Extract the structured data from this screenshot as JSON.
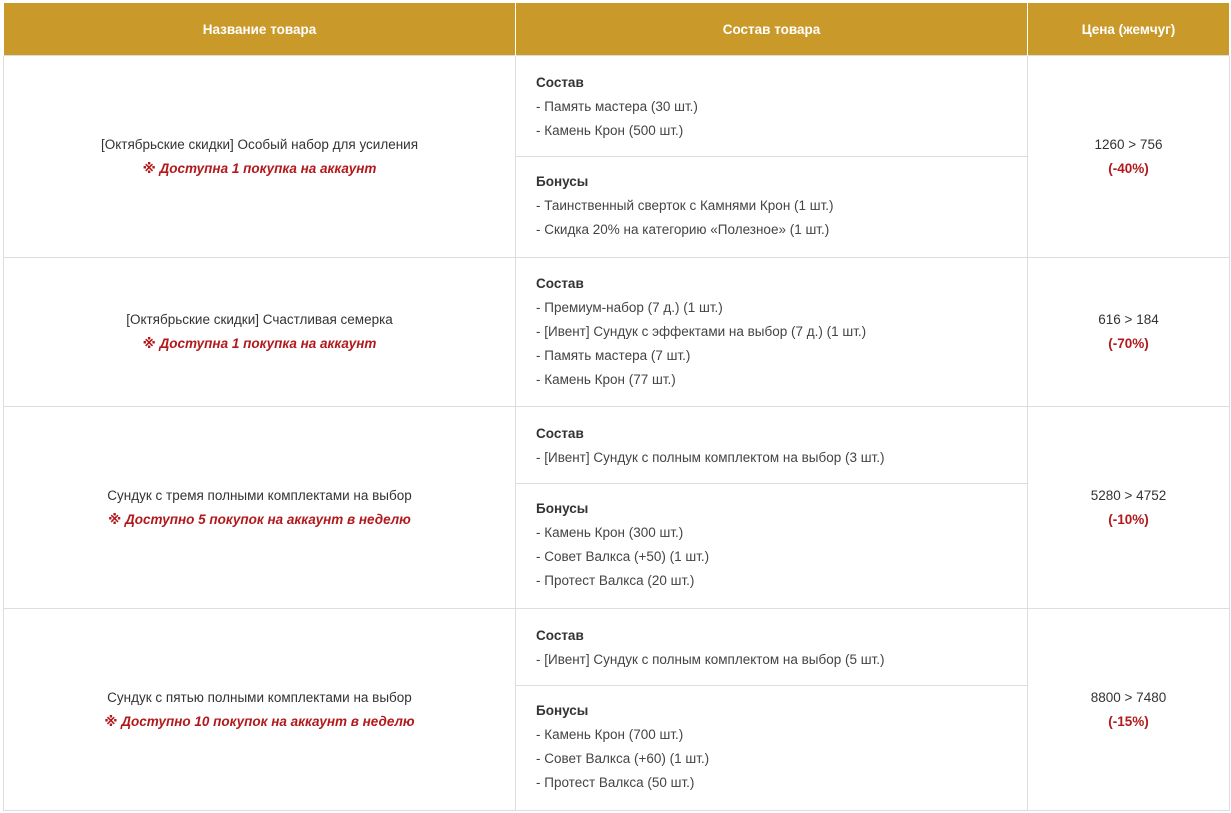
{
  "headers": {
    "name": "Название товара",
    "contents": "Состав товара",
    "price": "Цена (жемчуг)"
  },
  "rows": [
    {
      "name": "[Октябрьские скидки] Особый набор для усиления",
      "note": "※ Доступна 1 покупка на аккаунт",
      "price": "1260 > 756",
      "discount": "(-40%)",
      "sections": [
        {
          "title": "Состав",
          "items": [
            "- Память мастера (30 шт.)",
            "- Камень Крон (500 шт.)"
          ]
        },
        {
          "title": "Бонусы",
          "items": [
            "- Таинственный сверток с Камнями Крон (1 шт.)",
            "- Скидка 20% на категорию «Полезное» (1 шт.)"
          ]
        }
      ]
    },
    {
      "name": "[Октябрьские скидки] Счастливая семерка",
      "note": "※ Доступна 1 покупка на аккаунт",
      "price": "616 > 184",
      "discount": "(-70%)",
      "sections": [
        {
          "title": "Состав",
          "items": [
            "- Премиум-набор (7 д.) (1 шт.)",
            "- [Ивент] Сундук с эффектами на выбор (7 д.) (1 шт.)",
            "- Память мастера (7 шт.)",
            "- Камень Крон (77 шт.)"
          ]
        }
      ]
    },
    {
      "name": "Сундук с тремя полными комплектами на выбор",
      "note": "※ Доступно 5 покупок на аккаунт в неделю",
      "price": "5280 > 4752",
      "discount": "(-10%)",
      "sections": [
        {
          "title": "Состав",
          "items": [
            "- [Ивент] Сундук с полным комплектом на выбор (3 шт.)"
          ]
        },
        {
          "title": "Бонусы",
          "items": [
            "- Камень Крон (300 шт.)",
            "- Совет Валкса (+50) (1 шт.)",
            "- Протест Валкса (20 шт.)"
          ]
        }
      ]
    },
    {
      "name": "Сундук с пятью полными комплектами на выбор",
      "note": "※ Доступно 10 покупок на аккаунт в неделю",
      "price": "8800 > 7480",
      "discount": "(-15%)",
      "sections": [
        {
          "title": "Состав",
          "items": [
            "- [Ивент] Сундук с полным комплектом на выбор (5 шт.)"
          ]
        },
        {
          "title": "Бонусы",
          "items": [
            "- Камень Крон (700 шт.)",
            "- Совет Валкса (+60) (1 шт.)",
            "- Протест Валкса (50 шт.)"
          ]
        }
      ]
    }
  ]
}
